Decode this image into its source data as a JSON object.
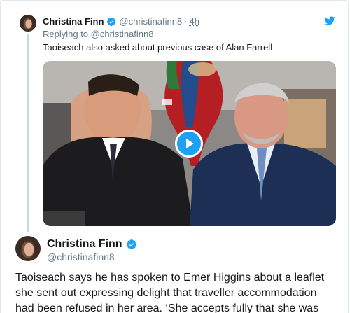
{
  "colors": {
    "accent": "#1da1f2",
    "text": "#14171a",
    "secondary_text": "#657786",
    "border": "#e1e8ed"
  },
  "reply_tweet": {
    "author_name": "Christina Finn",
    "author_handle": "@christinafinn8",
    "separator": "·",
    "time": "4h",
    "replying_prefix": "Replying to",
    "replying_to": "@christinafinn8",
    "text": "Taoiseach also asked about previous case of Alan Farrell",
    "media_type": "video",
    "icons": [
      "verified-badge-icon",
      "twitter-bird-icon",
      "play-icon"
    ]
  },
  "main_tweet": {
    "author_name": "Christina Finn",
    "author_handle": "@christinafinn8",
    "text_lines": [
      "Taoiseach says he has spoken to Emer Higgins about a leaflet",
      "she sent out expressing delight that traveller accommodation",
      "had been refused in her area. ‘She accepts fully that she was"
    ],
    "icons": [
      "verified-badge-icon"
    ]
  }
}
